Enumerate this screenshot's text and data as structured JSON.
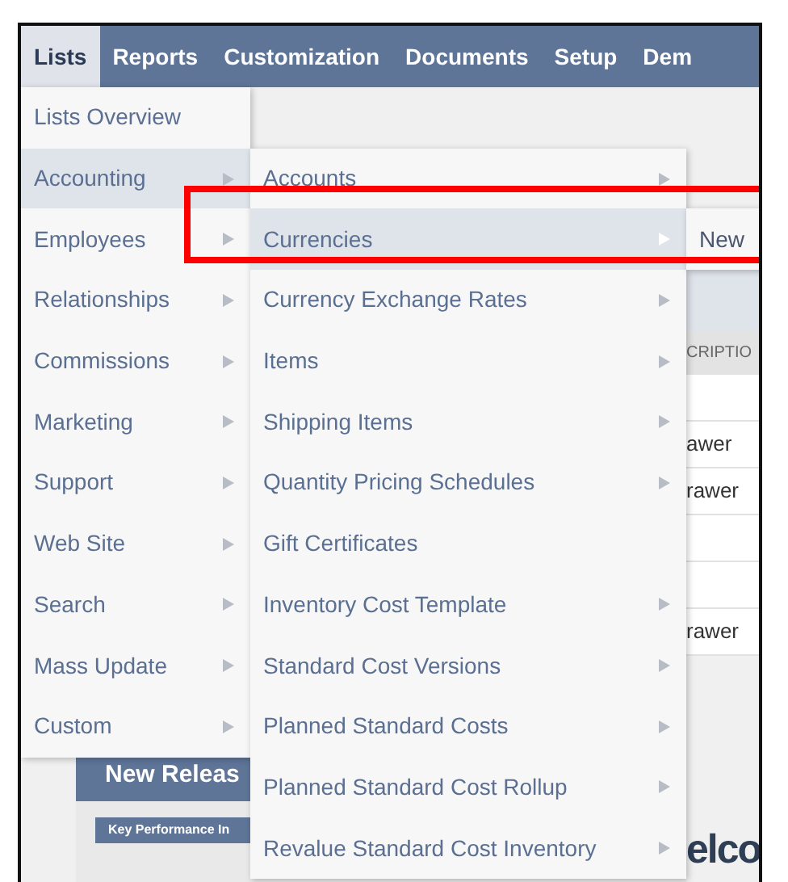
{
  "nav": [
    {
      "label": "Lists",
      "selected": true
    },
    {
      "label": "Reports",
      "selected": false
    },
    {
      "label": "Customization",
      "selected": false
    },
    {
      "label": "Documents",
      "selected": false
    },
    {
      "label": "Setup",
      "selected": false
    },
    {
      "label": "Dem",
      "selected": false
    }
  ],
  "menu": [
    {
      "label": "Lists Overview",
      "has_submenu": false,
      "selected": false
    },
    {
      "label": "Accounting",
      "has_submenu": true,
      "selected": true
    },
    {
      "label": "Employees",
      "has_submenu": true,
      "selected": false
    },
    {
      "label": "Relationships",
      "has_submenu": true,
      "selected": false
    },
    {
      "label": "Commissions",
      "has_submenu": true,
      "selected": false
    },
    {
      "label": "Marketing",
      "has_submenu": true,
      "selected": false
    },
    {
      "label": "Support",
      "has_submenu": true,
      "selected": false
    },
    {
      "label": "Web Site",
      "has_submenu": true,
      "selected": false
    },
    {
      "label": "Search",
      "has_submenu": true,
      "selected": false
    },
    {
      "label": "Mass Update",
      "has_submenu": true,
      "selected": false
    },
    {
      "label": "Custom",
      "has_submenu": true,
      "selected": false
    }
  ],
  "submenu": [
    {
      "label": "Accounts",
      "has_submenu": true,
      "selected": false
    },
    {
      "label": "Currencies",
      "has_submenu": true,
      "selected": true
    },
    {
      "label": "Currency Exchange Rates",
      "has_submenu": true,
      "selected": false
    },
    {
      "label": "Items",
      "has_submenu": true,
      "selected": false
    },
    {
      "label": "Shipping Items",
      "has_submenu": true,
      "selected": false
    },
    {
      "label": "Quantity Pricing Schedules",
      "has_submenu": true,
      "selected": false
    },
    {
      "label": "Gift Certificates",
      "has_submenu": false,
      "selected": false
    },
    {
      "label": "Inventory Cost Template",
      "has_submenu": true,
      "selected": false
    },
    {
      "label": "Standard Cost Versions",
      "has_submenu": true,
      "selected": false
    },
    {
      "label": "Planned Standard Costs",
      "has_submenu": true,
      "selected": false
    },
    {
      "label": "Planned Standard Cost Rollup",
      "has_submenu": true,
      "selected": false
    },
    {
      "label": "Revalue Standard Cost Inventory",
      "has_submenu": true,
      "selected": false
    }
  ],
  "flyout": [
    {
      "label": "New"
    }
  ],
  "background": {
    "column_header": "CRIPTIO",
    "rows": [
      {
        "text": "awer"
      },
      {
        "text": "rawer"
      },
      {
        "text": "rawer"
      }
    ],
    "panel_title": "New Releas",
    "kpi_title": "Key Performance In",
    "welcome": "elco"
  }
}
